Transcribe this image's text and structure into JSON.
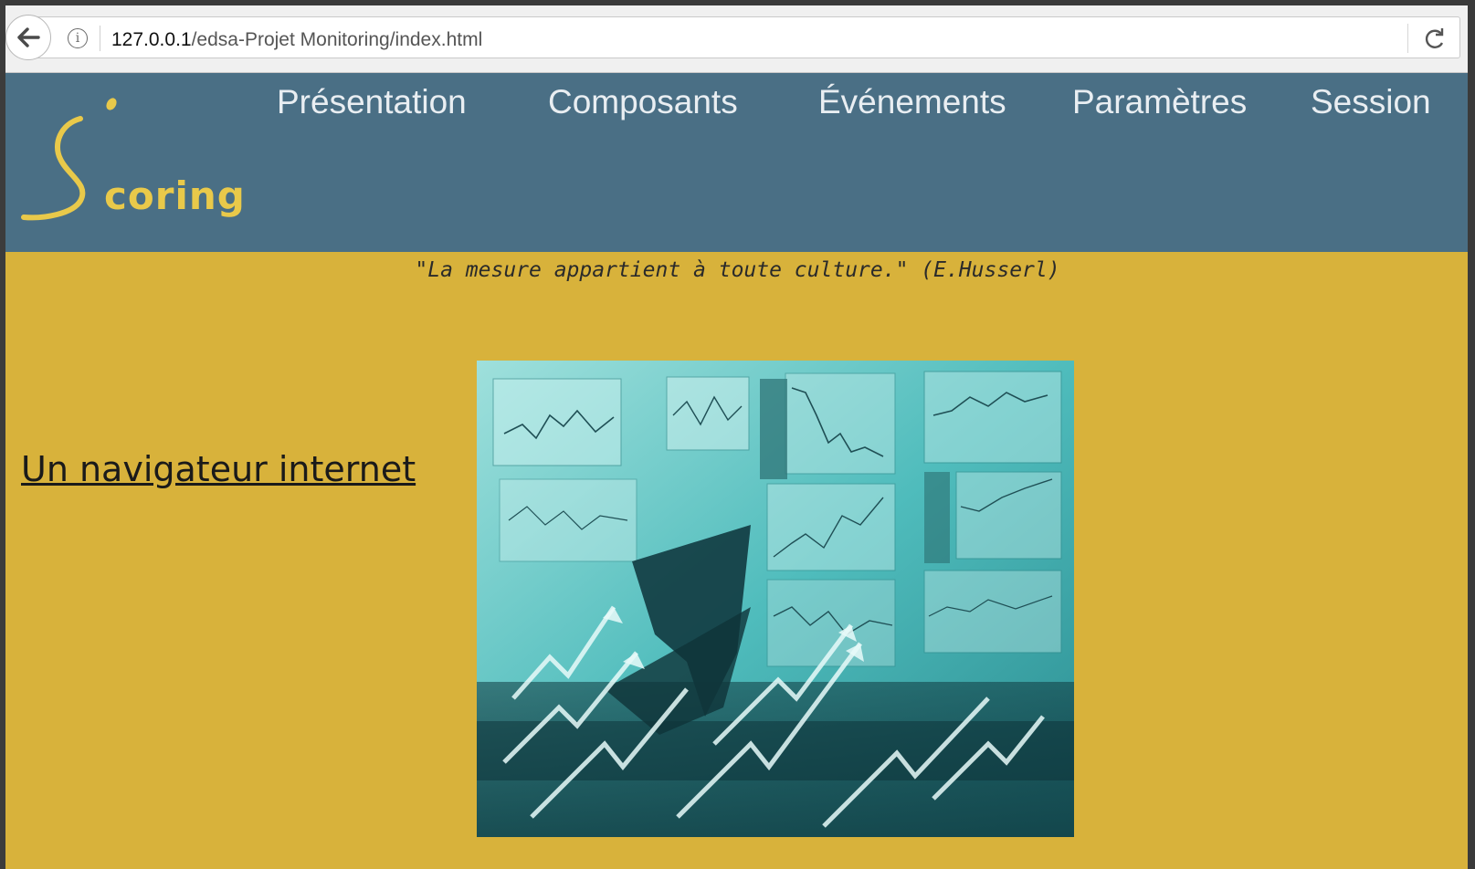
{
  "browser": {
    "url_host": "127.0.0.1",
    "url_path": "/edsa-Projet Monitoring/index.html"
  },
  "site": {
    "logo_text": "coring",
    "nav": [
      {
        "label": "Présentation"
      },
      {
        "label": "Composants"
      },
      {
        "label": "Événements"
      },
      {
        "label": "Paramètres"
      },
      {
        "label": "Session"
      }
    ],
    "quote": "\"La mesure appartient à toute culture.\" (E.Husserl)",
    "side_link": "Un navigateur internet"
  },
  "colors": {
    "header_bg": "#4a6f85",
    "page_bg": "#d8b23b",
    "logo": "#e9c94a"
  },
  "icons": [
    "back-arrow-icon",
    "info-icon",
    "reload-icon"
  ]
}
